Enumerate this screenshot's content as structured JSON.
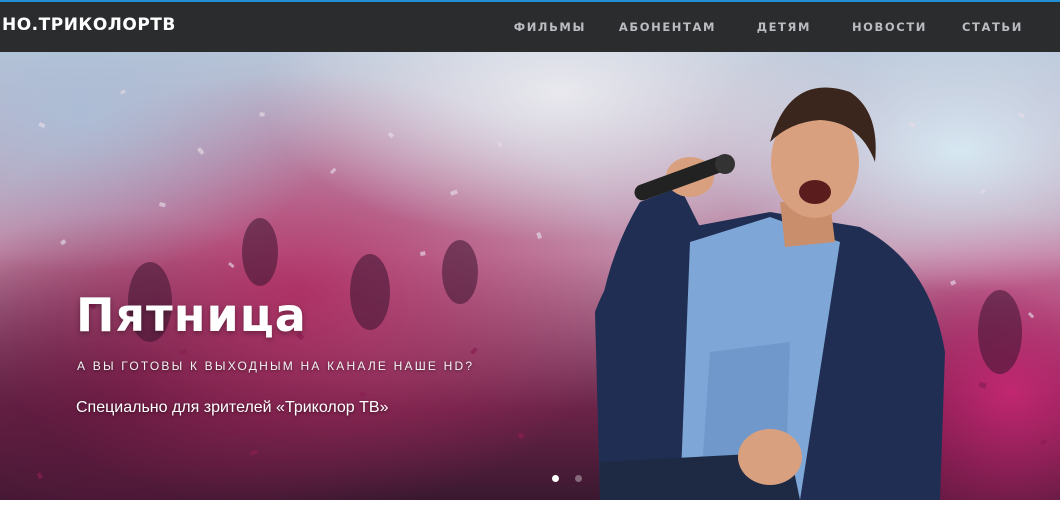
{
  "header": {
    "logo_text": "НО.ТРИКОЛОРТВ",
    "nav": [
      {
        "label": "ФИЛЬМЫ"
      },
      {
        "label": "АБОНЕНТАМ"
      },
      {
        "label": "ДЕТЯМ"
      },
      {
        "label": "НОВОСТИ"
      },
      {
        "label": "СТАТЬИ"
      }
    ],
    "accent_color": "#1f8fd6",
    "bar_color": "#2b2c2e"
  },
  "hero": {
    "title": "Пятница",
    "subtitle": "А ВЫ ГОТОВЫ К ВЫХОДНЫМ НА КАНАЛЕ НАШЕ HD?",
    "text": "Специально для зрителей «Триколор ТВ»",
    "image": "singer-with-microphone-concert-crowd",
    "slides_total": 2,
    "active_slide": 1
  }
}
